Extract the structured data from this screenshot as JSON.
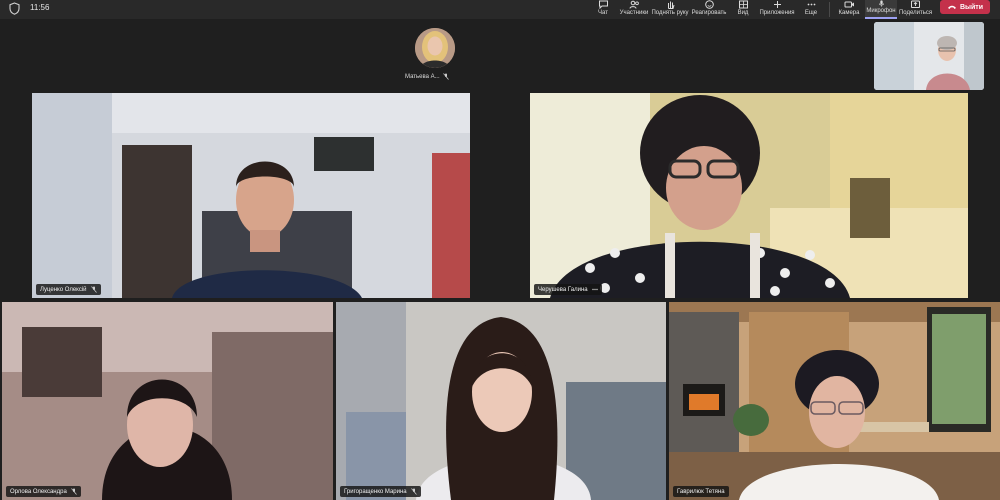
{
  "status_bar": {
    "time": "11:56"
  },
  "toolbar": {
    "items": [
      {
        "label": "Чат"
      },
      {
        "label": "Участники"
      },
      {
        "label": "Поднять руку"
      },
      {
        "label": "Реагировать"
      },
      {
        "label": "Вид"
      },
      {
        "label": "Приложения"
      },
      {
        "label": "Еще"
      },
      {
        "label": "Камера"
      },
      {
        "label": "Микрофон"
      },
      {
        "label": "Поделиться"
      }
    ],
    "leave_label": "Выйти"
  },
  "colors": {
    "leave": "#c4314b",
    "speaking_border": "#7f85f5",
    "background": "#1f1f1f"
  },
  "top_participant": {
    "name": "Матьева А..."
  },
  "participants": [
    {
      "name": "Луценко Олексій"
    },
    {
      "name": "Черушева Галина"
    },
    {
      "name": "Орлова Олександра"
    },
    {
      "name": "Григоращенко Марина"
    },
    {
      "name": "Гаврилюк Тетяна"
    }
  ]
}
